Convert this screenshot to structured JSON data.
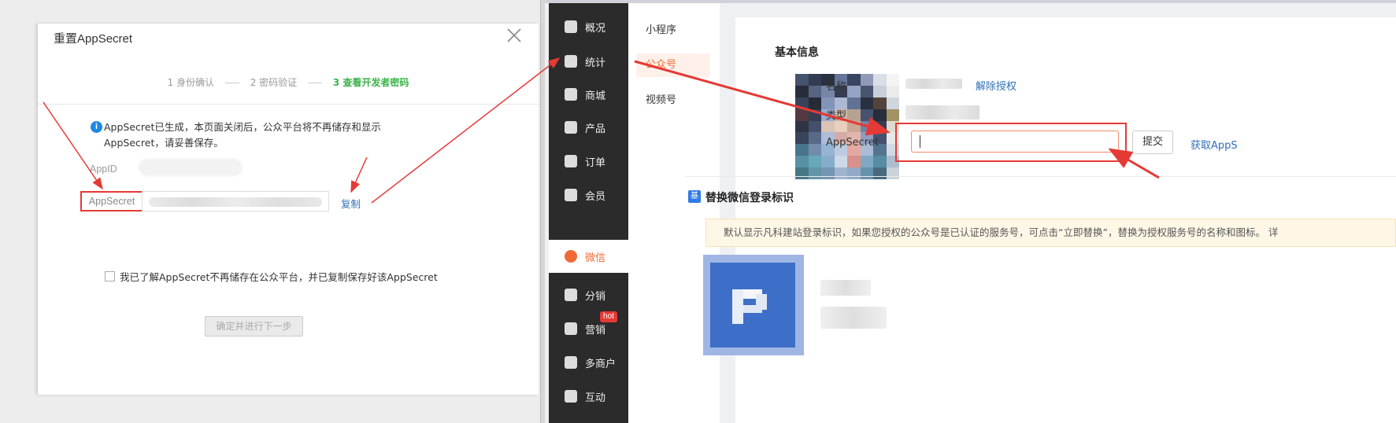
{
  "dialog": {
    "title": "重置AppSecret",
    "steps": [
      "1 身份确认",
      "2 密码验证",
      "3 查看开发者密码"
    ],
    "notice": "AppSecret已生成，本页面关闭后，公众平台将不再储存和显示AppSecret，请妥善保存。",
    "appid_label": "AppID",
    "appsecret_label": "AppSecret",
    "copy_label": "复制",
    "checkbox_label": "我已了解AppSecret不再储存在公众平台，并已复制保存好该AppSecret",
    "next_button": "确定并进行下一步"
  },
  "sidebar": {
    "items": [
      {
        "label": "概况",
        "icon": "layers-icon"
      },
      {
        "label": "统计",
        "icon": "chart-icon"
      },
      {
        "label": "商城",
        "icon": "shop-icon"
      },
      {
        "label": "产品",
        "icon": "grid-icon"
      },
      {
        "label": "订单",
        "icon": "order-icon"
      },
      {
        "label": "会员",
        "icon": "crown-icon"
      },
      {
        "label": "微信",
        "icon": "wechat-icon"
      },
      {
        "label": "分销",
        "icon": "users-icon"
      },
      {
        "label": "营销",
        "icon": "flag-icon"
      },
      {
        "label": "多商户",
        "icon": "store-icon"
      },
      {
        "label": "互动",
        "icon": "interact-icon"
      }
    ],
    "hot_badge": "hot",
    "active_color": "#f06a35"
  },
  "subnav": {
    "items": [
      "小程序",
      "公众号",
      "视频号"
    ]
  },
  "basic_info": {
    "title": "基本信息",
    "name_label": "名称",
    "unauthorize_link": "解除授权",
    "type_label": "类型",
    "appsecret_label": "AppSecret",
    "submit_button": "提交",
    "get_link": "获取AppS"
  },
  "replace_section": {
    "icon_text": "基",
    "title": "替换微信登录标识",
    "tip": "默认显示凡科建站登录标识，如果您授权的公众号是已认证的服务号，可点击“立即替换”，替换为授权服务号的名称和图标。 详"
  }
}
